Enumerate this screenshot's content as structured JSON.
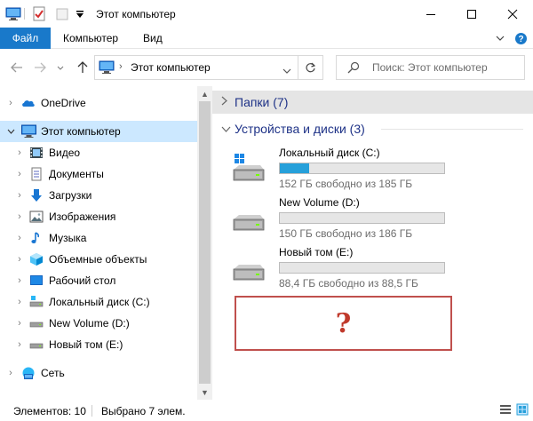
{
  "window": {
    "title": "Этот компьютер"
  },
  "ribbon": {
    "tabs": [
      {
        "label": "Файл",
        "active": true
      },
      {
        "label": "Компьютер"
      },
      {
        "label": "Вид"
      }
    ]
  },
  "address": {
    "path": "Этот компьютер",
    "search_placeholder": "Поиск: Этот компьютер"
  },
  "nav": {
    "items": [
      {
        "label": "OneDrive",
        "icon": "cloud-icon",
        "expandable": true
      },
      {
        "label": "Этот компьютер",
        "icon": "computer-icon",
        "expanded": true,
        "selected": true
      },
      {
        "label": "Видео",
        "icon": "video-icon",
        "expandable": true
      },
      {
        "label": "Документы",
        "icon": "documents-icon",
        "expandable": true
      },
      {
        "label": "Загрузки",
        "icon": "downloads-icon",
        "expandable": true
      },
      {
        "label": "Изображения",
        "icon": "pictures-icon",
        "expandable": true
      },
      {
        "label": "Музыка",
        "icon": "music-icon",
        "expandable": true
      },
      {
        "label": "Объемные объекты",
        "icon": "3d-objects-icon",
        "expandable": true
      },
      {
        "label": "Рабочий стол",
        "icon": "desktop-icon",
        "expandable": true
      },
      {
        "label": "Локальный диск (C:)",
        "icon": "drive-icon",
        "expandable": true
      },
      {
        "label": "New Volume (D:)",
        "icon": "drive-icon",
        "expandable": true
      },
      {
        "label": "Новый том (E:)",
        "icon": "drive-icon",
        "expandable": true
      },
      {
        "label": "Сеть",
        "icon": "network-icon",
        "expandable": true
      }
    ]
  },
  "content": {
    "groups": [
      {
        "label": "Папки (7)",
        "collapsed": true
      },
      {
        "label": "Устройства и диски (3)",
        "collapsed": false
      }
    ],
    "drives": [
      {
        "name": "Локальный диск (C:)",
        "free": "152 ГБ свободно из 185 ГБ",
        "used_fraction": 0.18,
        "system": true
      },
      {
        "name": "New Volume (D:)",
        "free": "150 ГБ свободно из 186 ГБ",
        "used_fraction": 0.0,
        "system": false
      },
      {
        "name": "Новый том (E:)",
        "free": "88,4 ГБ свободно из 88,5 ГБ",
        "used_fraction": 0.0,
        "system": false
      }
    ],
    "placeholder_mark": "?"
  },
  "status": {
    "items_count": "Элементов: 10",
    "selected_count": "Выбрано 7 элем."
  },
  "colors": {
    "accent": "#1979ca",
    "selection": "#cce8ff",
    "drive_fill": "#26a0da",
    "group_header": "#1e3287",
    "placeholder_border": "#c0504d"
  }
}
